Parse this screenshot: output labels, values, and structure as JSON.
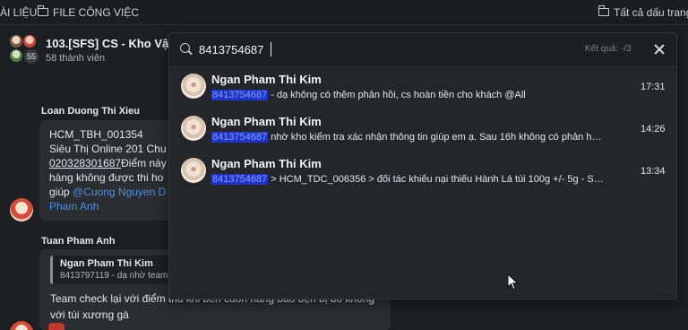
{
  "bookmarks": {
    "items": [
      {
        "label": "ÀI LIỆU"
      },
      {
        "label": "FILE CÔNG VIỆC"
      }
    ],
    "all_label": "Tất cả dấu trang"
  },
  "header": {
    "group_name": "103.[SFS] CS - Kho Vận",
    "member_count_badge": "55",
    "members_label": "58 thành viên"
  },
  "conversation": {
    "msg1": {
      "sender": "Loan Duong Thi Xieu",
      "lines": [
        "HCM_TBH_001354",
        "Siêu Thị Online 201 Chu",
        "02",
        "0328301687",
        "Điểm này",
        "hàng không được thi ho",
        "giúp ",
        "@Cuong Nguyen D",
        "Pham Anh"
      ]
    },
    "msg2": {
      "sender": "Tuan Pham Anh",
      "quote_name": "Ngan Pham Thi Kim",
      "quote_text": "8413797119 - dạ nhờ team",
      "line1": "Team check lại với điểm thu khi bên cuồn hàng bảo bện bị bỏ không",
      "line2": "với túi xương gà"
    }
  },
  "search": {
    "query": "8413754687",
    "result_count": "Kết quả: -/3",
    "results": [
      {
        "name": "Ngan Pham Thi Kim",
        "highlight": "8413754687",
        "text": " - dạ không có thêm phản hồi, cs hoàn tiền cho khách @All",
        "time": "17:31"
      },
      {
        "name": "Ngan Pham Thi Kim",
        "highlight": "8413754687",
        "text": " nhờ kho kiểm tra xác nhận thông tin giúp em ạ. Sau 16h không có phản hồi,...",
        "time": "14:26"
      },
      {
        "name": "Ngan Pham Thi Kim",
        "highlight": "8413754687",
        "text": " > HCM_TDC_006356 > đối tác khiếu nại thiếu Hành Lá túi 100g +/- 5g - SL ...",
        "time": "13:34"
      }
    ]
  },
  "icons": [
    "folder-icon",
    "search-icon",
    "close-icon",
    "mouse-cursor-icon"
  ]
}
